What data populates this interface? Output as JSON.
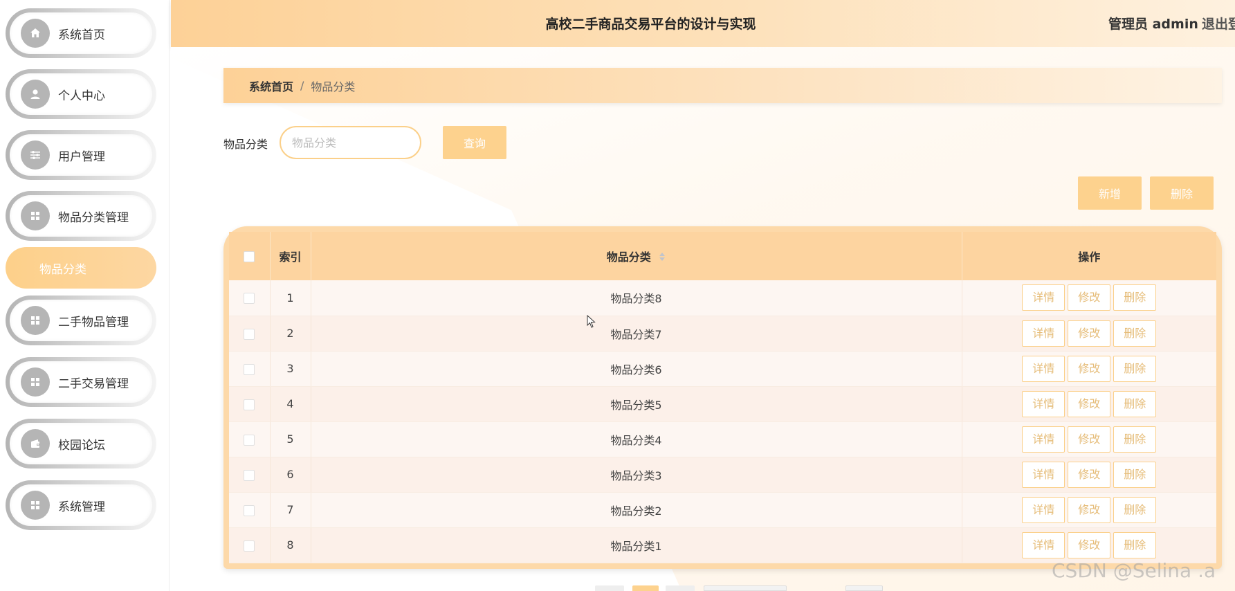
{
  "header": {
    "title": "高校二手商品交易平台的设计与实现",
    "user": "管理员 admin",
    "logout": "退出登录"
  },
  "sidebar": {
    "items": [
      {
        "label": "系统首页",
        "icon": "home-icon"
      },
      {
        "label": "个人中心",
        "icon": "user-icon"
      },
      {
        "label": "用户管理",
        "icon": "sliders-icon"
      },
      {
        "label": "物品分类管理",
        "icon": "grid-icon"
      },
      {
        "label": "二手物品管理",
        "icon": "grid-icon"
      },
      {
        "label": "二手交易管理",
        "icon": "grid-icon"
      },
      {
        "label": "校园论坛",
        "icon": "wallet-icon"
      },
      {
        "label": "系统管理",
        "icon": "grid-icon"
      }
    ],
    "active_sub": "物品分类"
  },
  "breadcrumb": {
    "home": "系统首页",
    "sep": "/",
    "current": "物品分类"
  },
  "search": {
    "label": "物品分类",
    "placeholder": "物品分类",
    "value": "",
    "button": "查询"
  },
  "actions": {
    "add": "新增",
    "delete": "删除"
  },
  "table": {
    "columns": [
      "索引",
      "物品分类",
      "操作"
    ],
    "rows": [
      {
        "index": "1",
        "category": "物品分类8"
      },
      {
        "index": "2",
        "category": "物品分类7"
      },
      {
        "index": "3",
        "category": "物品分类6"
      },
      {
        "index": "4",
        "category": "物品分类5"
      },
      {
        "index": "5",
        "category": "物品分类4"
      },
      {
        "index": "6",
        "category": "物品分类3"
      },
      {
        "index": "7",
        "category": "物品分类2"
      },
      {
        "index": "8",
        "category": "物品分类1"
      }
    ],
    "row_actions": {
      "detail": "详情",
      "edit": "修改",
      "delete": "删除"
    }
  },
  "watermark": "CSDN @Selina .a",
  "colors": {
    "accent": "#fdd28e",
    "header_start": "#fdd197",
    "icon_bg": "#b5b5b5",
    "op_text": "#e6bd7a"
  }
}
